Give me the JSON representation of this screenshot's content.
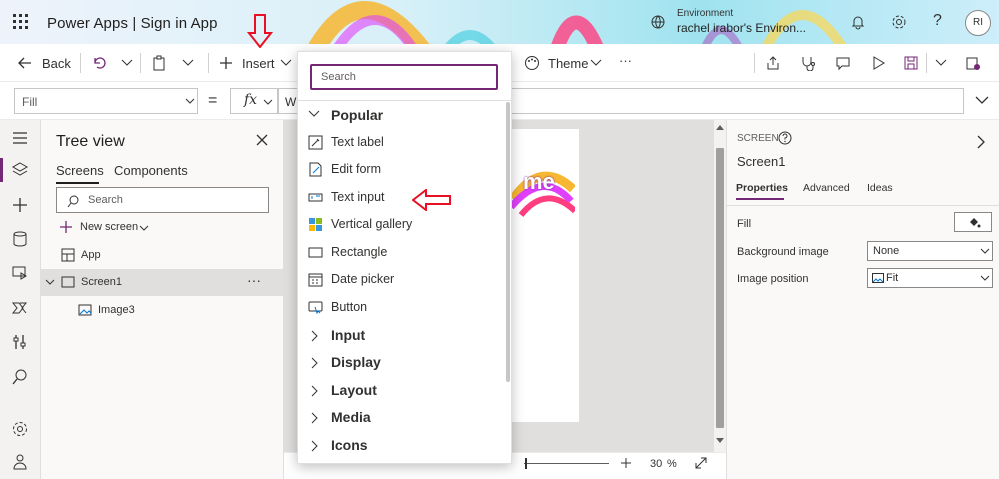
{
  "titlebar": {
    "app_title": "Power Apps  |  Sign in App",
    "environment_label": "Environment",
    "environment_name": "rachel irabor's Environ...",
    "avatar_initials": "RI"
  },
  "commandbar": {
    "back_label": "Back",
    "insert_label": "Insert",
    "theme_label": "Theme",
    "more_label": "···"
  },
  "formulabar": {
    "property": "Fill",
    "equals": "=",
    "fx_label": "fx",
    "formula_value": "Wh"
  },
  "treeview": {
    "title": "Tree view",
    "tabs": [
      "Screens",
      "Components"
    ],
    "search_placeholder": "Search",
    "new_screen_label": "New screen",
    "items": [
      {
        "label": "App"
      },
      {
        "label": "Screen1",
        "more": "···"
      },
      {
        "label": "Image3"
      }
    ]
  },
  "canvas": {
    "zoom_value": "30",
    "zoom_unit": "%",
    "image_text": "me"
  },
  "properties": {
    "type_label": "SCREEN",
    "screen_name": "Screen1",
    "tabs": [
      "Properties",
      "Advanced",
      "Ideas"
    ],
    "fill_label": "Fill",
    "background_image_label": "Background image",
    "background_image_value": "None",
    "image_position_label": "Image position",
    "image_position_value": "Fit"
  },
  "insert_menu": {
    "search_placeholder": "Search",
    "popular_header": "Popular",
    "popular_items": [
      "Text label",
      "Edit form",
      "Text input",
      "Vertical gallery",
      "Rectangle",
      "Date picker",
      "Button"
    ],
    "categories": [
      "Input",
      "Display",
      "Layout",
      "Media",
      "Icons"
    ]
  },
  "colors": {
    "accent": "#742774",
    "annotation": "#e81123"
  }
}
